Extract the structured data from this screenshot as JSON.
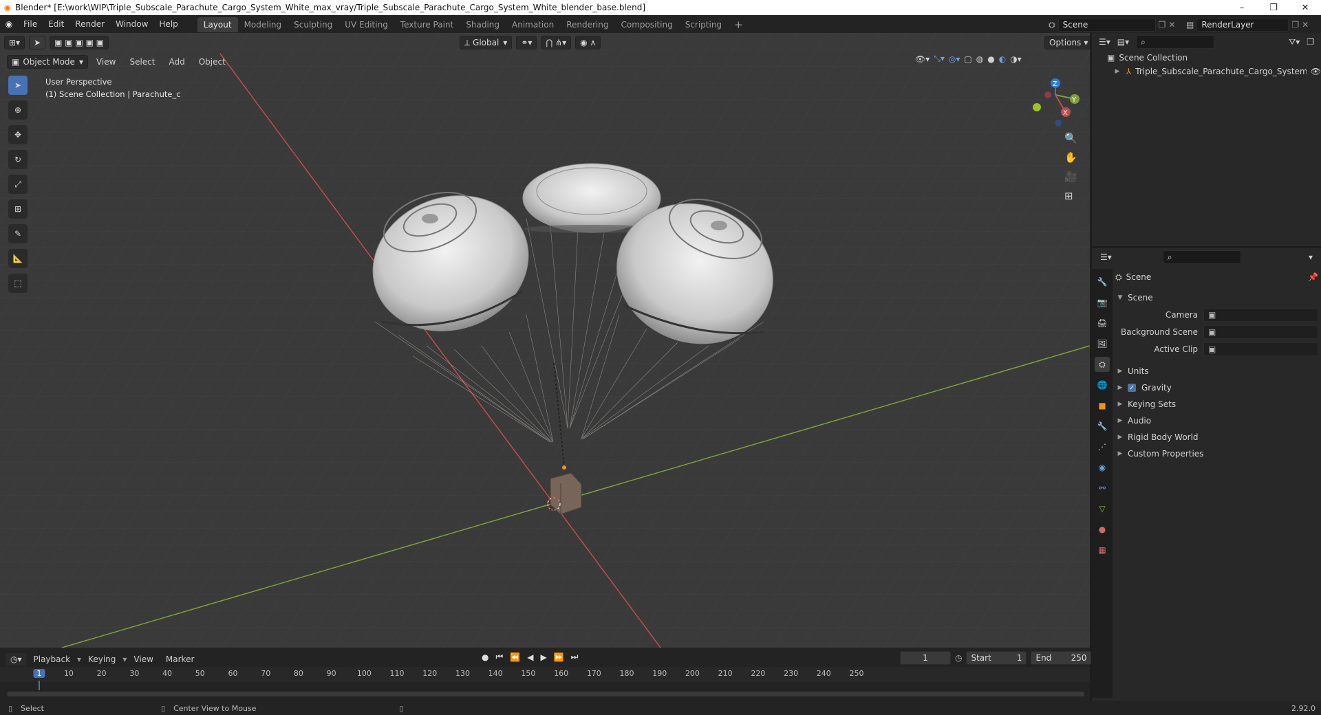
{
  "window": {
    "title": "Blender* [E:\\work\\WIP\\Triple_Subscale_Parachute_Cargo_System_White_max_vray/Triple_Subscale_Parachute_Cargo_System_White_blender_base.blend]",
    "controls": [
      "–",
      "❐",
      "✕"
    ]
  },
  "menubar": {
    "items": [
      "File",
      "Edit",
      "Render",
      "Window",
      "Help"
    ],
    "workspaces": [
      "Layout",
      "Modeling",
      "Sculpting",
      "UV Editing",
      "Texture Paint",
      "Shading",
      "Animation",
      "Rendering",
      "Compositing",
      "Scripting"
    ],
    "add_workspace": "+",
    "scene": "Scene",
    "view_layer": "RenderLayer"
  },
  "viewport": {
    "transform_orientation": "Global",
    "options_label": "Options",
    "mode": "Object Mode",
    "menus": [
      "View",
      "Select",
      "Add",
      "Object"
    ],
    "overlay_title": "User Perspective",
    "overlay_subtitle": "(1) Scene Collection | Parachute_c",
    "gizmo_axes": {
      "x": "X",
      "y": "Y",
      "z": "Z"
    },
    "colors": {
      "x_axis": "#c24b4f",
      "y_axis": "#7fa13a",
      "z_axis": "#2f7bd6",
      "grid": "#444444"
    }
  },
  "outliner": {
    "root": "Scene Collection",
    "object": "Triple_Subscale_Parachute_Cargo_System_W"
  },
  "properties": {
    "context": "Scene",
    "panel_title": "Scene",
    "fields": [
      {
        "label": "Camera",
        "value": ""
      },
      {
        "label": "Background Scene",
        "value": ""
      },
      {
        "label": "Active Clip",
        "value": ""
      }
    ],
    "subpanels": [
      "Units",
      "Gravity",
      "Keying Sets",
      "Audio",
      "Rigid Body World",
      "Custom Properties"
    ],
    "gravity_enabled": true
  },
  "timeline": {
    "menus": [
      "Playback",
      "Keying",
      "View",
      "Marker"
    ],
    "current_frame": "1",
    "start_label": "Start",
    "start": "1",
    "end_label": "End",
    "end": "250",
    "ruler": [
      "1",
      "10",
      "20",
      "30",
      "40",
      "50",
      "60",
      "70",
      "80",
      "90",
      "100",
      "110",
      "120",
      "130",
      "140",
      "150",
      "160",
      "170",
      "180",
      "190",
      "200",
      "210",
      "220",
      "230",
      "240",
      "250"
    ]
  },
  "statusbar": {
    "left": "Select",
    "middle": "Center View to Mouse",
    "version": "2.92.0"
  }
}
